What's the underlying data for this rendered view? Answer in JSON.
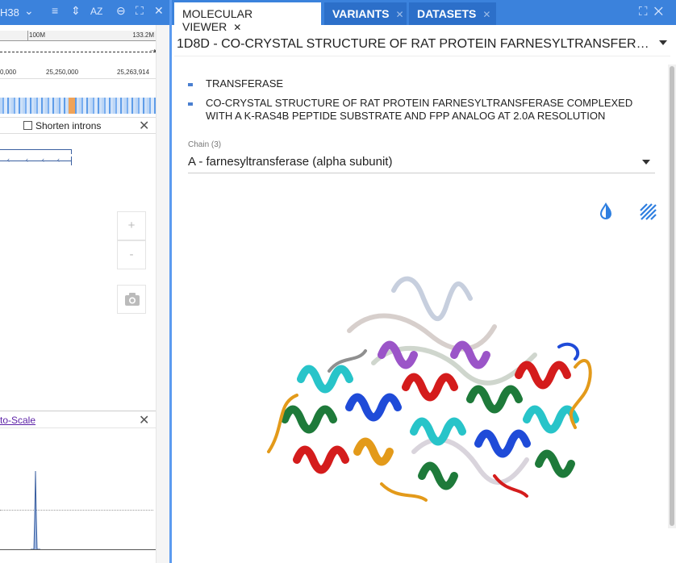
{
  "left_panel": {
    "assembly_label": "H38",
    "ruler_labels": {
      "mark_100": "100M",
      "mark_end": "133.2M"
    },
    "coord_labels": [
      "0,000",
      "25,250,000",
      "25,263,914"
    ],
    "shorten_introns_label": "Shorten introns",
    "shorten_introns_checked": false,
    "panel2_link": "to-Scale"
  },
  "tabs": [
    {
      "label": "MOLECULAR VIEWER",
      "active": true
    },
    {
      "label": "VARIANTS",
      "active": false
    },
    {
      "label": "DATASETS",
      "active": false
    }
  ],
  "structure": {
    "selected": "1D8D  - CO-CRYSTAL STRUCTURE OF RAT PROTEIN FARNESYLTRANSFERASE COMPLEXED WITH A K-RAS4B PEPTIDE SUBSTRATE AND FPP ANALOG AT 2.0A RESOLUTION",
    "bullets": [
      "TRANSFERASE",
      "CO-CRYSTAL STRUCTURE OF RAT PROTEIN FARNESYLTRANSFERASE COMPLEXED WITH A K-RAS4B PEPTIDE SUBSTRATE AND FPP ANALOG AT 2.0A RESOLUTION"
    ]
  },
  "chain": {
    "label": "Chain (3)",
    "selected": "A - farnesyltransferase (alpha subunit)"
  },
  "colors": {
    "accent": "#3b82dc",
    "tab_inactive": "#2c6fc9",
    "icon_blue": "#2f7fe0"
  }
}
